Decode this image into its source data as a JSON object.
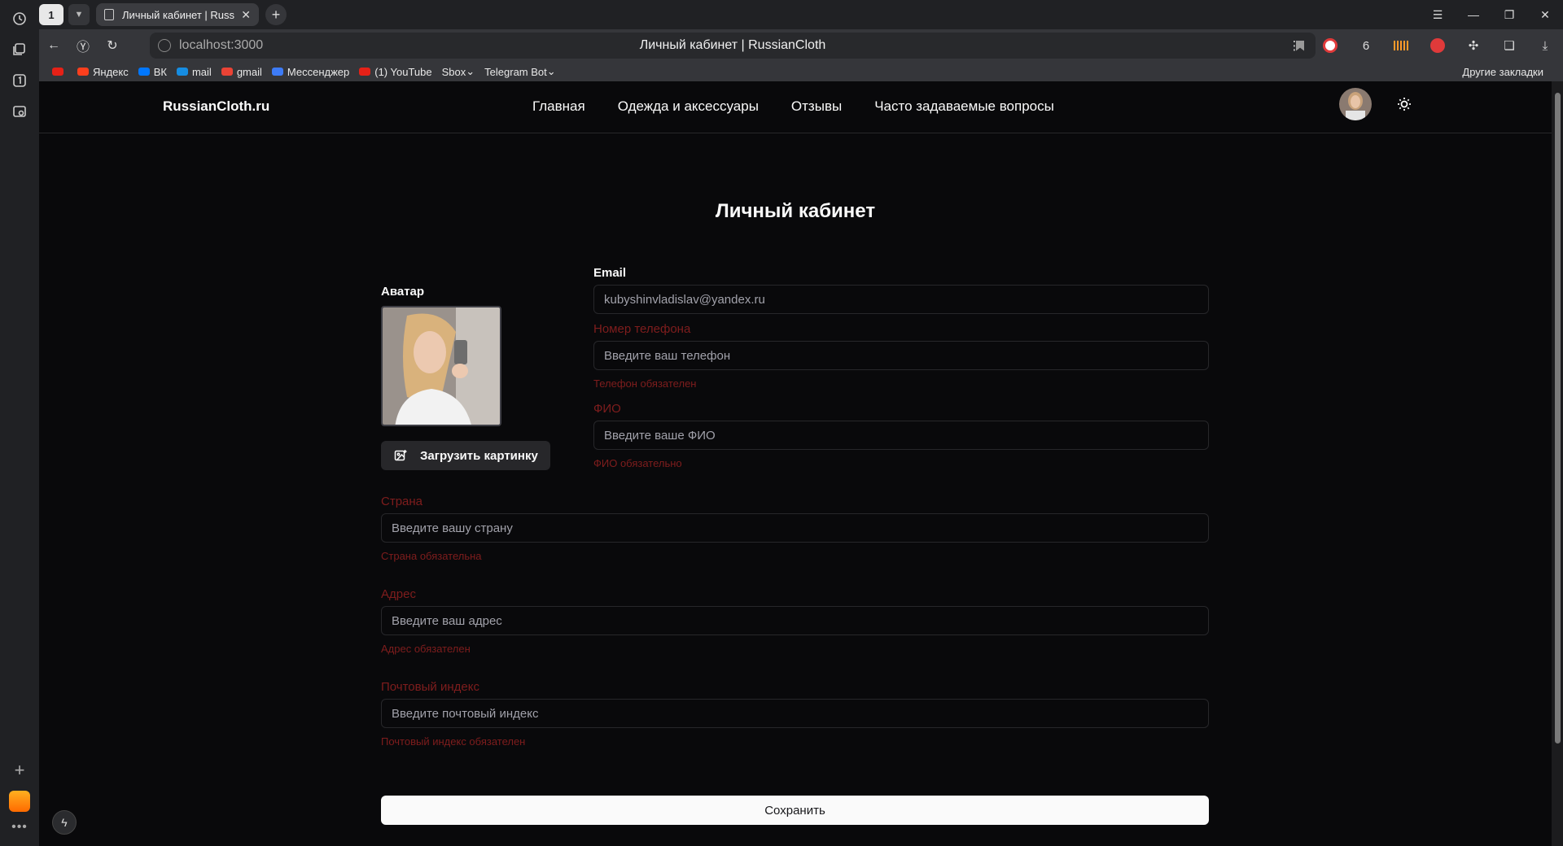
{
  "browser": {
    "tab_count": "1",
    "tab_title": "Личный кабинет | Russ",
    "url": "localhost:3000",
    "page_title": "Личный кабинет | RussianCloth",
    "bookmarks": [
      {
        "label": "",
        "color": "#e62117"
      },
      {
        "label": "Яндекс",
        "color": "#fc3f1d"
      },
      {
        "label": "ВК",
        "color": "#0077ff"
      },
      {
        "label": "mail",
        "color": "#168de2"
      },
      {
        "label": "gmail",
        "color": "#ea4335"
      },
      {
        "label": "Мессенджер",
        "color": "#3d7bf6"
      },
      {
        "label": "(1) YouTube",
        "color": "#e62117"
      },
      {
        "label": "Sbox",
        "color": ""
      },
      {
        "label": "Telegram Bot",
        "color": ""
      }
    ],
    "other_bookmarks": "Другие закладки",
    "ext_badge": "6"
  },
  "site": {
    "logo": "RussianCloth.ru",
    "nav": [
      "Главная",
      "Одежда и аксессуары",
      "Отзывы",
      "Часто задаваемые вопросы"
    ]
  },
  "profile": {
    "title": "Личный кабинет",
    "avatar_label": "Аватар",
    "upload_label": "Загрузить картинку",
    "email_label": "Email",
    "email_value": "kubyshinvladislav@yandex.ru",
    "phone_label": "Номер телефона",
    "phone_placeholder": "Введите ваш телефон",
    "phone_error": "Телефон обязателен",
    "fio_label": "ФИО",
    "fio_placeholder": "Введите ваше ФИО",
    "fio_error": "ФИО обязательно",
    "country_label": "Страна",
    "country_placeholder": "Введите вашу страну",
    "country_error": "Страна обязательна",
    "address_label": "Адрес",
    "address_placeholder": "Введите ваш адрес",
    "address_error": "Адрес обязателен",
    "zip_label": "Почтовый индекс",
    "zip_placeholder": "Введите почтовый индекс",
    "zip_error": "Почтовый индекс обязателен",
    "save_label": "Сохранить"
  },
  "colors": {
    "background": "#09090b",
    "error": "#7f1d1d",
    "border": "#27272a",
    "primary": "#fafafa"
  }
}
